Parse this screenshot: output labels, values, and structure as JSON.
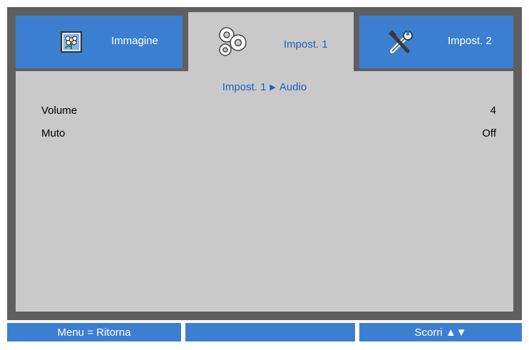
{
  "tabs": [
    {
      "label": "Immagine",
      "icon": "flower-image-icon",
      "active": false
    },
    {
      "label": "Impost. 1",
      "icon": "gears-icon",
      "active": true
    },
    {
      "label": "Impost. 2",
      "icon": "tools-icon",
      "active": false
    }
  ],
  "breadcrumb": {
    "parent": "Impost. 1",
    "separator": "▶",
    "current": "Audio"
  },
  "settings": [
    {
      "label": "Volume",
      "value": "4"
    },
    {
      "label": "Muto",
      "value": "Off"
    }
  ],
  "footer": {
    "left": "Menu = Ritorna",
    "middle": "",
    "right": "Scorri ▲▼"
  },
  "colors": {
    "accent": "#3c7fd1",
    "panel": "#c9c9c9",
    "frame": "#5f5f5f",
    "highlight_text": "#1f5fc4"
  }
}
